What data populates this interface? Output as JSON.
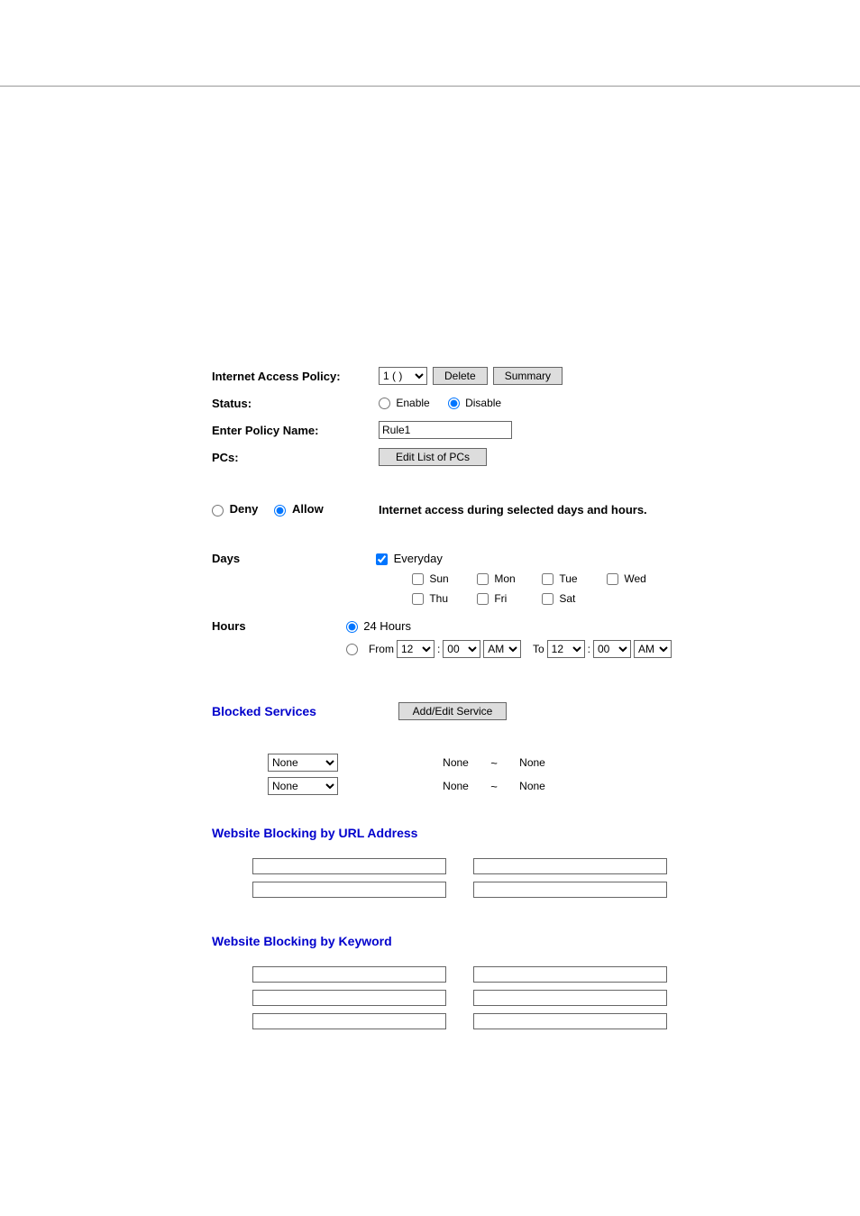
{
  "labels": {
    "internet_access_policy": "Internet Access Policy:",
    "status": "Status:",
    "enter_policy_name": "Enter Policy Name:",
    "pcs": "PCs:",
    "deny": "Deny",
    "allow": "Allow",
    "access_desc": "Internet access during selected days and hours.",
    "days": "Days",
    "hours": "Hours",
    "everyday": "Everyday",
    "sun": "Sun",
    "mon": "Mon",
    "tue": "Tue",
    "wed": "Wed",
    "thu": "Thu",
    "fri": "Fri",
    "sat": "Sat",
    "h24": "24 Hours",
    "from": "From",
    "to": "To",
    "blocked_services": "Blocked Services",
    "url_blocking": "Website Blocking by URL Address",
    "keyword_blocking": "Website Blocking by Keyword"
  },
  "buttons": {
    "delete": "Delete",
    "summary": "Summary",
    "edit_list_pcs": "Edit List of PCs",
    "add_edit_service": "Add/Edit Service"
  },
  "values": {
    "policy_selected": "1 ( )",
    "policy_name": "Rule1",
    "status_enable": "Enable",
    "status_disable": "Disable",
    "from_hr": "12",
    "from_min": "00",
    "from_ap": "AM",
    "to_hr": "12",
    "to_min": "00",
    "to_ap": "AM",
    "svc_none": "None",
    "colon": ":"
  }
}
